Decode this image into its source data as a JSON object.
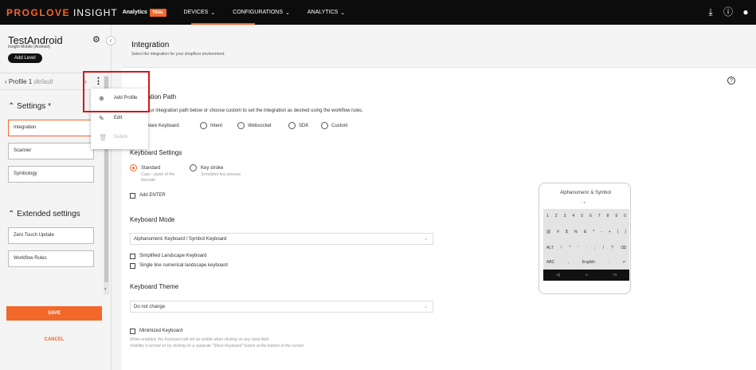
{
  "topbar": {
    "brand_a": "PROGLOVE",
    "brand_b": "INSIGHT",
    "brand_c": "Analytics",
    "trial": "TRIAL",
    "nav": [
      "DEVICES",
      "CONFIGURATIONS",
      "ANALYTICS"
    ],
    "icons": [
      "download-icon",
      "help-icon",
      "account-icon"
    ],
    "accent": "#f2672a"
  },
  "sidebar": {
    "title": "TestAndroid",
    "subtitle": "Insight Mobile (Android)",
    "add_level": "Add Level",
    "profile_label": "Profile 1",
    "profile_default": "default",
    "settings_header": "Settings *",
    "settings_items": [
      "Integration",
      "Scanner",
      "Symbology"
    ],
    "extended_header": "Extended settings",
    "extended_items": [
      "Zero Touch Update",
      "Workflow Rules"
    ],
    "save": "SAVE",
    "cancel": "CANCEL"
  },
  "menu": {
    "items": [
      {
        "label": "Add Profile",
        "icon": "add-circle-icon",
        "disabled": false
      },
      {
        "label": "Edit",
        "icon": "pencil-icon",
        "disabled": false
      },
      {
        "label": "Delete",
        "icon": "trash-icon",
        "disabled": true
      }
    ]
  },
  "main": {
    "title": "Integration",
    "subtitle": "Select the integration for your shopfloor environment.",
    "path_header": "ation Path",
    "path_desc": "our integration path below or choose custom to set the integration as desired using the workflow rules.",
    "path_options": [
      "ftware Keyboard",
      "Intent",
      "Websocket",
      "SDK",
      "Custom"
    ],
    "keyboard_settings": "Keyboard Settings",
    "standard": "Standard",
    "standard_hint": "Copy - paste of the barcode",
    "keystroke": "Key stroke",
    "keystroke_hint": "Simulated key presses",
    "add_enter": "Add ENTER",
    "keyboard_mode": "Keyboard Mode",
    "keyboard_mode_value": "Alphanumeric Keyboard / Symbol Keyboard",
    "simplified": "Simplified Landscape Keyboard",
    "single_line": "Single line numerical landscape keyboard",
    "keyboard_theme": "Keyboard Theme",
    "keyboard_theme_value": "Do not change",
    "minimized": "Minimized Keyboard",
    "minimized_hint1": "When enabled, the Keyboard will not be visible when clicking on any input field.",
    "minimized_hint2": "Visibility is turned on by clicking on a separate \"Show Keyboard\" button at the bottom of the screen."
  },
  "preview": {
    "title": "Alphanumeric & Symbol",
    "row1": [
      "1",
      "2",
      "3",
      "4",
      "5",
      "6",
      "7",
      "8",
      "9",
      "0"
    ],
    "row2": [
      "@",
      "#",
      "$",
      "%",
      "&",
      "*",
      "-",
      "+",
      "(",
      ")"
    ],
    "row3": [
      "ALT",
      "!",
      "\"",
      "'",
      ":",
      ";",
      "/",
      "?",
      "⌫"
    ],
    "row4": [
      "ABC",
      ",",
      "English",
      "·",
      "↵"
    ],
    "nav": [
      "◁",
      "○",
      "□"
    ]
  }
}
